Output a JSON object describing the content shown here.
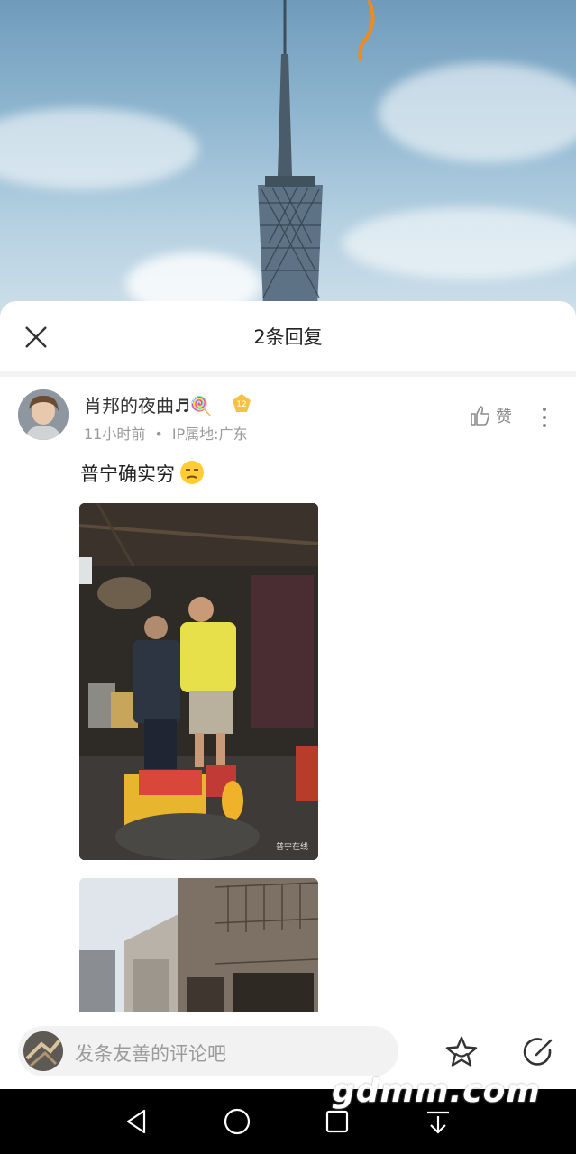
{
  "sheet": {
    "title": "2条回复"
  },
  "comment": {
    "username": "肖邦的夜曲♬🍭",
    "level_badge": "12",
    "time": "11小时前",
    "separator": "•",
    "ip_location": "IP属地:广东",
    "like_label": "赞",
    "text": "普宁确实穷"
  },
  "photo1": {
    "watermark_text": "普宁在线"
  },
  "input": {
    "placeholder": "发条友善的评论吧"
  },
  "watermark": {
    "text": "gdmm.com"
  },
  "colors": {
    "accent_badge": "#f5c242",
    "emoji": "#ffcc33",
    "text_primary": "#222222",
    "text_secondary": "#9a9a9a"
  },
  "icons": [
    "close-icon",
    "thumbs-up-icon",
    "more-vertical-icon",
    "star-icon",
    "edit-icon",
    "back-icon",
    "home-icon",
    "recent-apps-icon",
    "download-icon"
  ]
}
